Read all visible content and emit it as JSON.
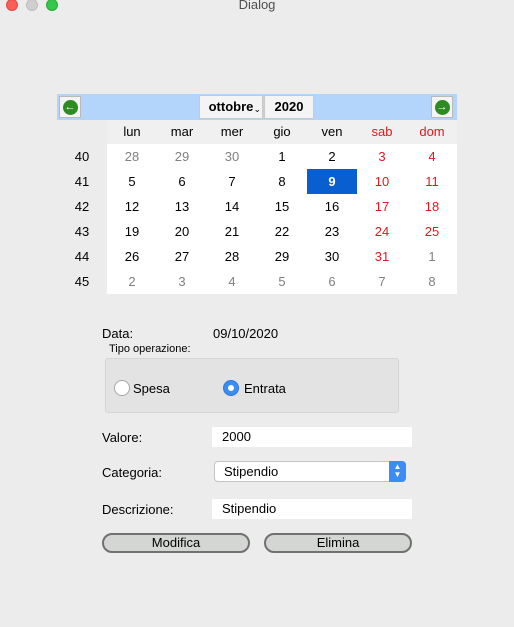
{
  "window": {
    "title": "Dialog"
  },
  "calendar": {
    "month": "ottobre",
    "year": "2020",
    "weekdays": [
      "lun",
      "mar",
      "mer",
      "gio",
      "ven",
      "sab",
      "dom"
    ],
    "weeks": [
      {
        "num": "40",
        "days": [
          "28",
          "29",
          "30",
          "1",
          "2",
          "3",
          "4"
        ]
      },
      {
        "num": "41",
        "days": [
          "5",
          "6",
          "7",
          "8",
          "9",
          "10",
          "11"
        ]
      },
      {
        "num": "42",
        "days": [
          "12",
          "13",
          "14",
          "15",
          "16",
          "17",
          "18"
        ]
      },
      {
        "num": "43",
        "days": [
          "19",
          "20",
          "21",
          "22",
          "23",
          "24",
          "25"
        ]
      },
      {
        "num": "44",
        "days": [
          "26",
          "27",
          "28",
          "29",
          "30",
          "31",
          "1"
        ]
      },
      {
        "num": "45",
        "days": [
          "2",
          "3",
          "4",
          "5",
          "6",
          "7",
          "8"
        ]
      }
    ],
    "selected_day": "9",
    "colors": {
      "weekend": "#e0181d",
      "other_month": "#808080",
      "selected": "#0a5fd0",
      "nav_bar": "#b3d5fb"
    }
  },
  "form": {
    "data_label": "Data:",
    "data_value": "09/10/2020",
    "tipo_title": "Tipo operazione:",
    "radio_spesa": "Spesa",
    "radio_entrata": "Entrata",
    "selected_radio": "Entrata",
    "valore_label": "Valore:",
    "valore_value": "2000",
    "categoria_label": "Categoria:",
    "categoria_value": "Stipendio",
    "descrizione_label": "Descrizione:",
    "descrizione_value": "Stipendio",
    "modifica_label": "Modifica",
    "elimina_label": "Elimina"
  }
}
